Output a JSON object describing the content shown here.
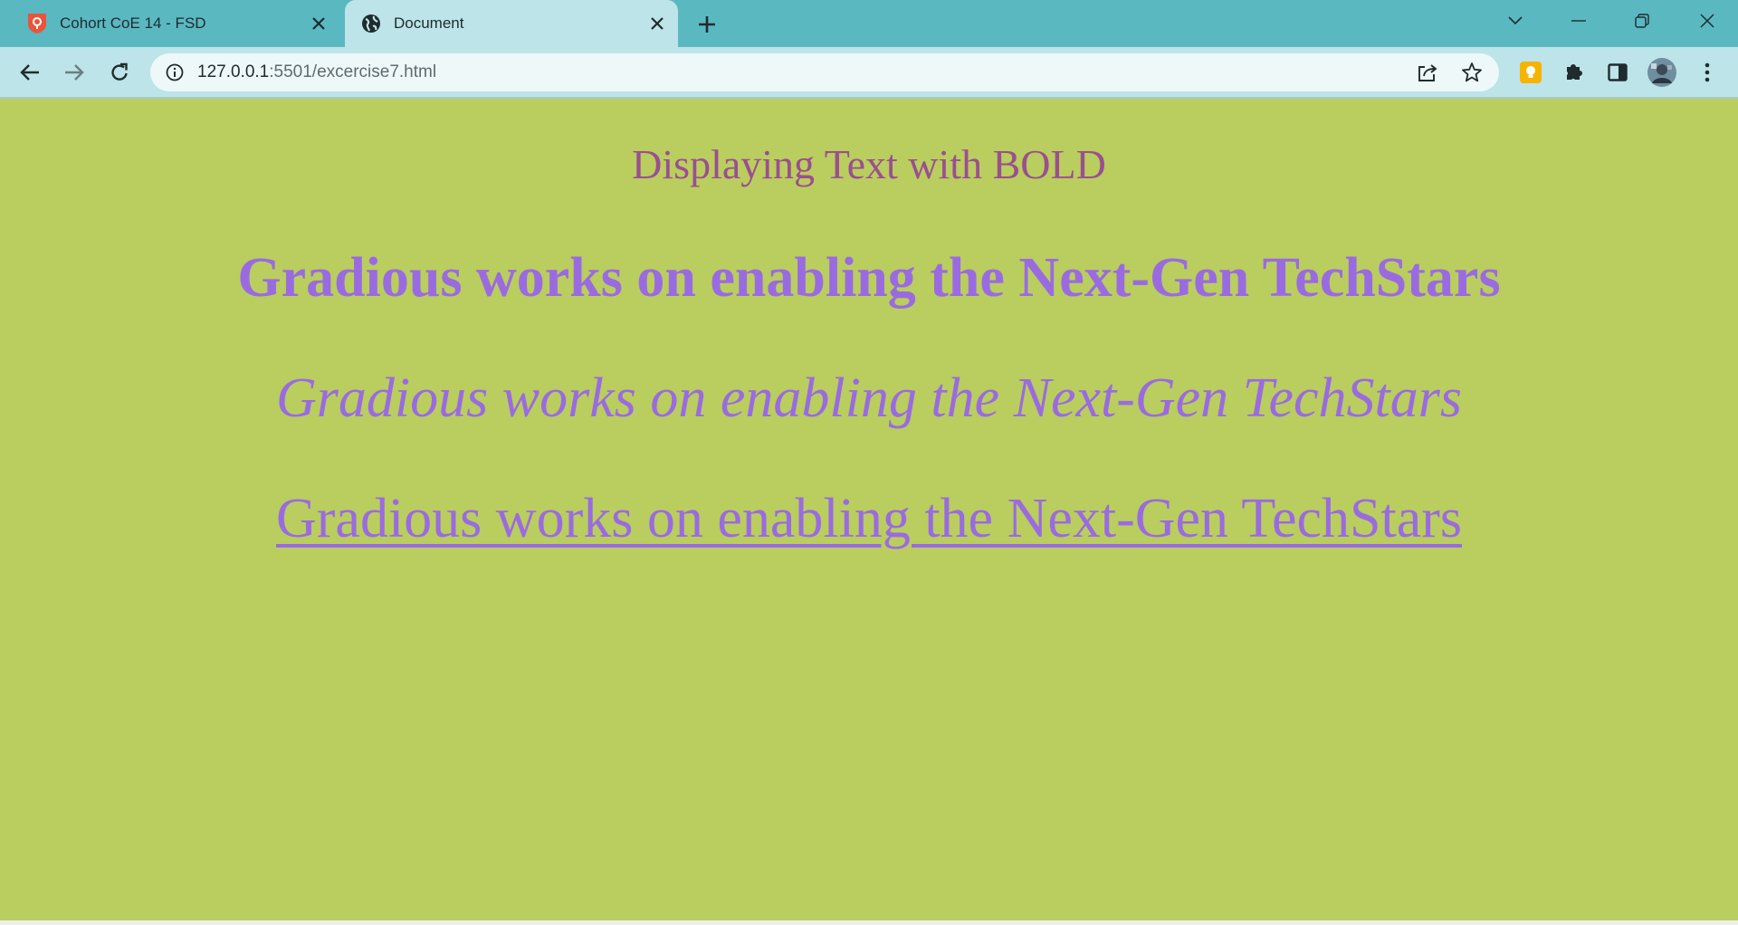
{
  "tabs": [
    {
      "title": "Cohort CoE 14 - FSD",
      "icon": "shield-favicon-icon",
      "active": false
    },
    {
      "title": "Document",
      "icon": "globe-icon",
      "active": true
    }
  ],
  "address_bar": {
    "host": "127.0.0.1",
    "rest": ":5501/excercise7.html"
  },
  "page": {
    "heading": "Displaying Text with BOLD",
    "bold_text": "Gradious works on enabling the Next-Gen TechStars",
    "italic_text": "Gradious works on enabling the Next-Gen TechStars",
    "underlined_text": "Gradious works on enabling the Next-Gen TechStars"
  },
  "colors": {
    "page_background": "#bacd5f",
    "heading_color": "#9a4f8f",
    "text_color": "#9a6be0",
    "tabstrip": "#5ab8c1",
    "toolbar": "#bde4e8"
  }
}
